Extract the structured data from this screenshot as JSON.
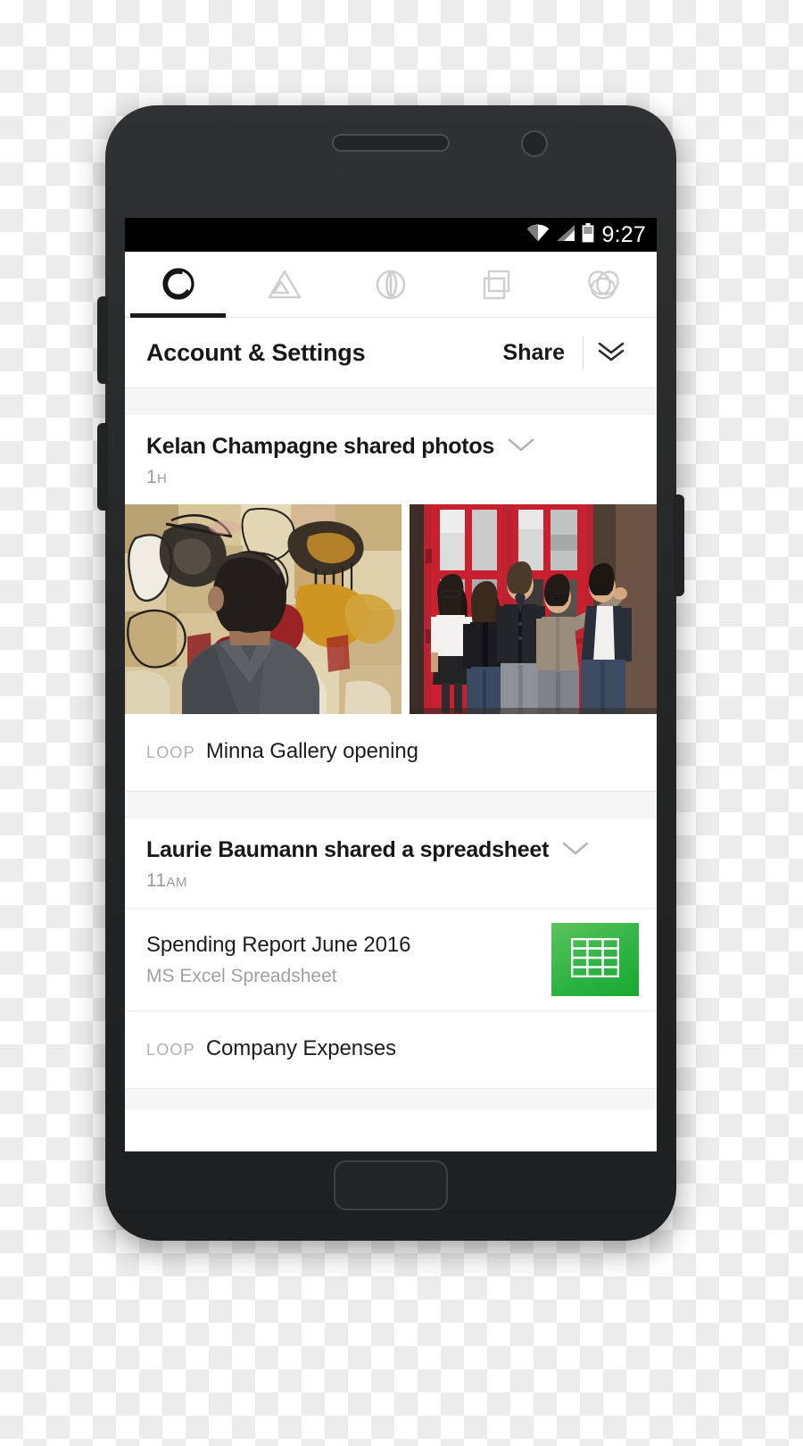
{
  "status_bar": {
    "time": "9:27",
    "icons": [
      "wifi-icon",
      "cellular-signal-icon",
      "battery-icon"
    ]
  },
  "tab_bar": {
    "tabs": [
      {
        "name": "loop-tab",
        "icon": "loop-circle-icon",
        "active": true
      },
      {
        "name": "mountain-tab",
        "icon": "mountain-triangle-icon",
        "active": false
      },
      {
        "name": "draw-tab",
        "icon": "circle-leaf-icon",
        "active": false
      },
      {
        "name": "comp-tab",
        "icon": "overlapping-frames-icon",
        "active": false
      },
      {
        "name": "rings-tab",
        "icon": "interlocking-rings-icon",
        "active": false
      }
    ]
  },
  "header": {
    "title": "Account & Settings",
    "share_label": "Share",
    "expand_icon": "double-chevron-down-icon"
  },
  "feed": [
    {
      "title": "Kelan Champagne shared photos",
      "chevron_icon": "chevron-down-icon",
      "time": "1",
      "time_unit": "H",
      "photos": [
        {
          "alt": "Man viewing an abstract painting in a gallery"
        },
        {
          "alt": "Group of five people posing in front of a red door"
        }
      ],
      "loop_tag": "LOOP",
      "loop_name": "Minna Gallery opening"
    },
    {
      "title": "Laurie Baumann shared a spreadsheet",
      "chevron_icon": "chevron-down-icon",
      "time": "11",
      "time_unit": "AM",
      "file": {
        "name": "Spending Report June 2016",
        "kind": "MS Excel Spreadsheet",
        "thumb_icon": "spreadsheet-grid-icon",
        "thumb_color": "#2fb344"
      },
      "loop_tag": "LOOP",
      "loop_name": "Company Expenses"
    }
  ],
  "colors": {
    "accent": "#1b1b1b",
    "text_primary": "#17181a",
    "text_muted": "#9a9a9a",
    "excel_green": "#2fb344",
    "band": "#f6f6f6"
  }
}
